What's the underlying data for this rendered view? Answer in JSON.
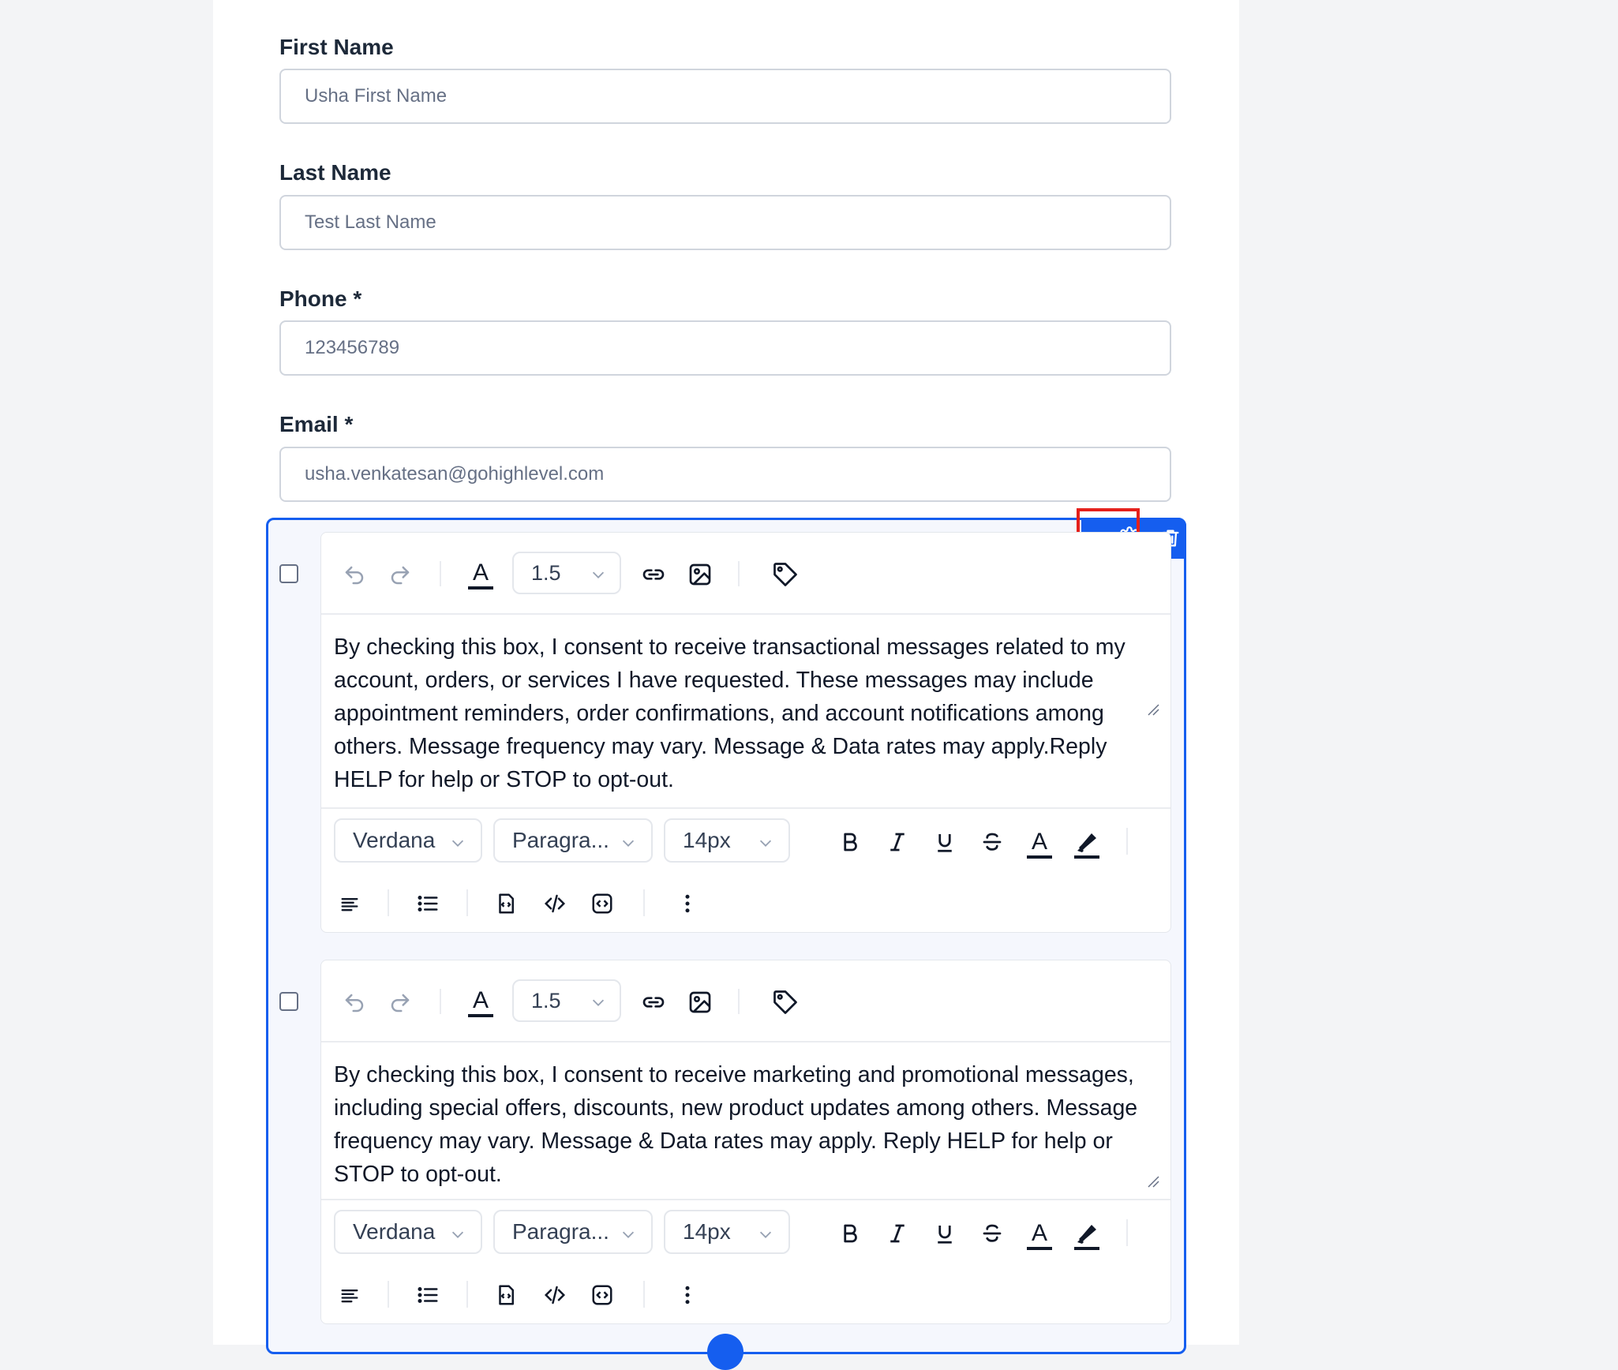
{
  "form": {
    "fields": [
      {
        "label": "First Name",
        "value": "Usha First Name"
      },
      {
        "label": "Last Name",
        "value": "Test Last Name"
      },
      {
        "label": "Phone *",
        "value": "123456789"
      },
      {
        "label": "Email *",
        "value": "usha.venkatesan@gohighlevel.com"
      }
    ]
  },
  "consent_block": {
    "actions": {
      "settings_icon": "gear-icon",
      "delete_icon": "trash-icon"
    },
    "editors": [
      {
        "line_height": "1.5",
        "content": "By checking this box, I consent to receive transactional messages related to my account, orders, or services I have requested. These messages may include appointment reminders, order confirmations, and account notifications among others. Message frequency may vary. Message & Data rates may apply.Reply HELP for help or STOP to opt-out.",
        "font_family": "Verdana",
        "block_type": "Paragra...",
        "font_size": "14px"
      },
      {
        "line_height": "1.5",
        "content": "By checking this box, I consent to receive marketing and promotional messages, including special offers, discounts, new product updates among others.  Message frequency may vary. Message & Data rates may apply. Reply HELP for help or STOP to opt-out.",
        "font_family": "Verdana",
        "block_type": "Paragra...",
        "font_size": "14px"
      }
    ]
  },
  "colors": {
    "accent": "#155eef",
    "highlight": "#e5201b"
  }
}
